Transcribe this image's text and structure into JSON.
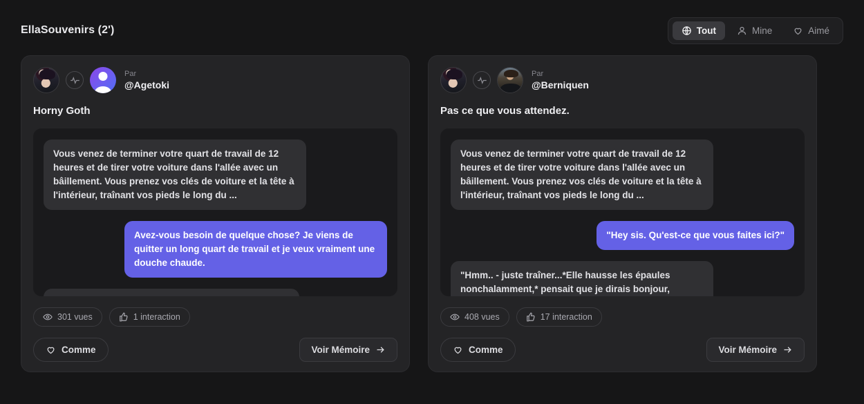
{
  "header": {
    "title": "EllaSouvenirs (2')",
    "filters": [
      {
        "label": "Tout",
        "icon": "globe-icon",
        "active": true
      },
      {
        "label": "Mine",
        "icon": "person-icon",
        "active": false
      },
      {
        "label": "Aimé",
        "icon": "heart-icon",
        "active": false
      }
    ]
  },
  "colors": {
    "page_bg": "#161617",
    "card_bg": "#242426",
    "chat_bg": "#1a1a1c",
    "bubble_them": "#303033",
    "bubble_me": "#6461e6",
    "accent": "#6461e6",
    "filter_active_bg": "#3a3a3e"
  },
  "cards": [
    {
      "by_label": "Par",
      "username": "@Agetoki",
      "title": "Horny Goth",
      "character_avatar": "goth-character-avatar",
      "link_icon": "pulse-icon",
      "user_avatar": "default-user-avatar",
      "messages": [
        {
          "side": "them",
          "text": "Vous venez de terminer votre quart de travail de 12 heures et de tirer votre voiture dans l'allée avec un bâillement. Vous prenez vos clés de voiture et la tête à l'intérieur, traînant vos pieds le long du ..."
        },
        {
          "side": "me",
          "text": "Avez-vous besoin de quelque chose? Je viens de quitter un long quart de travail et je veux vraiment une douche chaude."
        },
        {
          "side": "them",
          "text": ""
        }
      ],
      "stats": [
        {
          "icon": "eye-icon",
          "label": "301 vues"
        },
        {
          "icon": "thumbs-up-icon",
          "label": "1 interaction"
        }
      ],
      "like_label": "Comme",
      "memory_label": "Voir Mémoire"
    },
    {
      "by_label": "Par",
      "username": "@Berniquen",
      "title": "Pas ce que vous attendez.",
      "character_avatar": "goth-character-avatar",
      "link_icon": "pulse-icon",
      "user_avatar": "photo-user-avatar",
      "messages": [
        {
          "side": "them",
          "text": "Vous venez de terminer votre quart de travail de 12 heures et de tirer votre voiture dans l'allée avec un bâillement. Vous prenez vos clés de voiture et la tête à l'intérieur, traînant vos pieds le long du ..."
        },
        {
          "side": "me",
          "text": "\"Hey sis. Qu'est-ce que vous faites ici?\""
        },
        {
          "side": "them",
          "text": "\"Hmm.. - juste traîner...*Elle hausse les épaules nonchalamment,* pensait que je dirais bonjour,"
        }
      ],
      "stats": [
        {
          "icon": "eye-icon",
          "label": "408 vues"
        },
        {
          "icon": "thumbs-up-icon",
          "label": "17 interaction"
        }
      ],
      "like_label": "Comme",
      "memory_label": "Voir Mémoire"
    }
  ]
}
